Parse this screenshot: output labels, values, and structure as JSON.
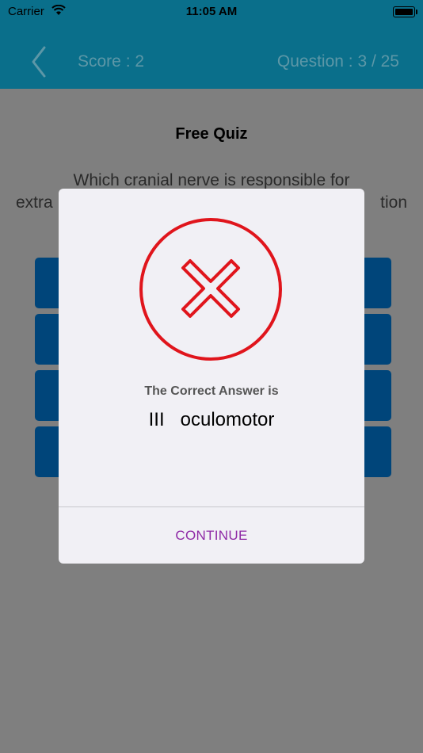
{
  "status_bar": {
    "carrier": "Carrier",
    "time": "11:05 AM"
  },
  "nav": {
    "score_label": "Score : 2",
    "question_label": "Question : 3 / 25"
  },
  "quiz": {
    "title": "Free Quiz",
    "question_line1": "Which cranial nerve is responsible for",
    "question_line2_left": "extra",
    "question_line2_right": "tion"
  },
  "dialog": {
    "icon": "x-circle-icon",
    "label": "The Correct Answer is",
    "answer": "III   oculomotor",
    "continue_label": "CONTINUE"
  },
  "colors": {
    "nav_bg": "#0a6f8b",
    "option_bg": "#00457a",
    "error_red": "#e0151c",
    "continue_purple": "#8f2aa6"
  }
}
